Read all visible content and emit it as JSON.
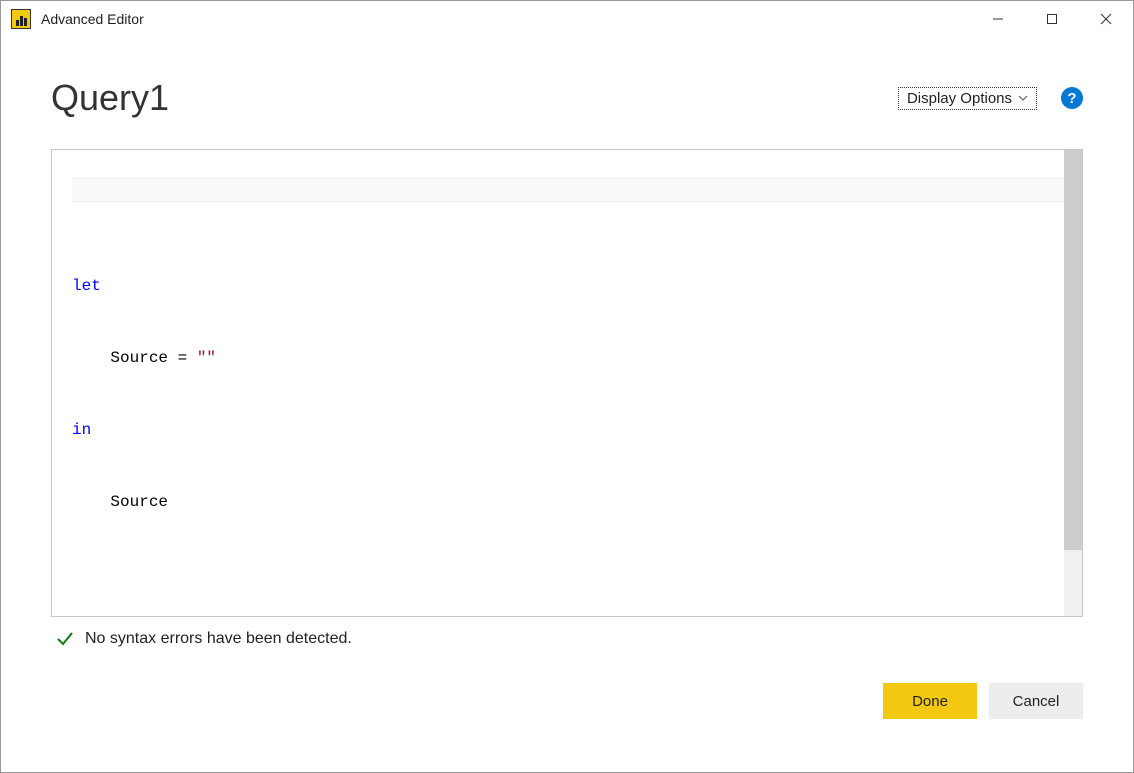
{
  "window": {
    "title": "Advanced Editor"
  },
  "header": {
    "query_name": "Query1",
    "display_options_label": "Display Options"
  },
  "editor": {
    "code": {
      "line1_kw": "let",
      "line2_indent": "    ",
      "line2_text": "Source = ",
      "line2_str": "\"\"",
      "line3_kw": "in",
      "line4_indent": "    ",
      "line4_text": "Source"
    }
  },
  "status": {
    "message": "No syntax errors have been detected."
  },
  "buttons": {
    "done": "Done",
    "cancel": "Cancel"
  }
}
